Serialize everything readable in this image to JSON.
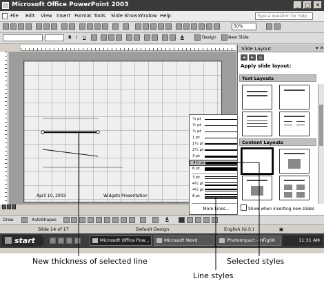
{
  "window": {
    "title": "Microsoft Office PowerPoint 2003"
  },
  "menu": {
    "items": [
      "File",
      "Edit",
      "View",
      "Insert",
      "Format",
      "Tools",
      "Slide Show",
      "Window",
      "Help"
    ],
    "help_placeholder": "Type a question for help"
  },
  "toolbar": {
    "zoom": "50%",
    "design_label": "Design",
    "new_slide_label": "New Slide"
  },
  "slide": {
    "date": "April 10, 2003",
    "footer": "Widgets Presentation"
  },
  "line_styles_menu": {
    "options": [
      "¼ pt",
      "½ pt",
      "¾ pt",
      "1 pt",
      "1½ pt",
      "2¼ pt",
      "3 pt",
      "4½ pt",
      "6 pt",
      "3 pt",
      "4½ pt",
      "4½ pt",
      "6 pt"
    ],
    "selected_index": 7,
    "more_label": "More Lines..."
  },
  "task_pane": {
    "title": "Slide Layout",
    "apply_label": "Apply slide layout:",
    "sections": [
      "Text Layouts",
      "Content Layouts"
    ],
    "show_label": "Show when inserting new slides"
  },
  "drawing_toolbar": {
    "draw_label": "Draw",
    "autoshapes_label": "AutoShapes"
  },
  "status": {
    "slide": "Slide 14 of 17",
    "design": "Default Design",
    "language": "English (U.S.)"
  },
  "taskbar": {
    "start": "start",
    "items": [
      "Microsoft Office Pow...",
      "Microsoft Word",
      "PhotoImpact - HFig06"
    ],
    "time": "11:31 AM"
  },
  "callouts": {
    "thickness": "New thickness of selected line",
    "line_styles": "Line styles",
    "selected_styles": "Selected styles"
  }
}
